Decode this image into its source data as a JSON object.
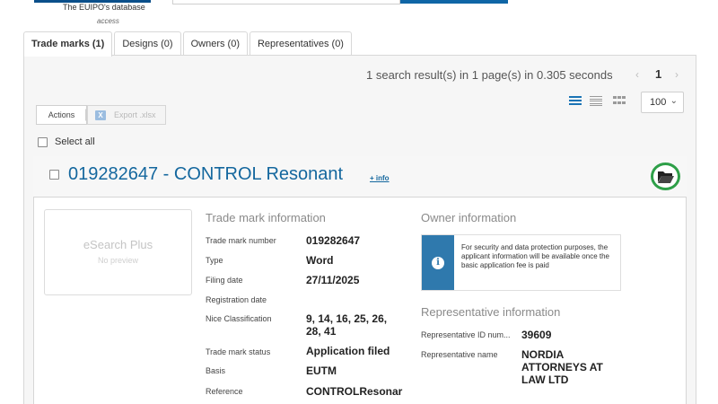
{
  "header": {
    "logo_subtitle": "The EUIPO's database",
    "logo_access": "access"
  },
  "tabs": [
    {
      "label": "Trade marks (1)"
    },
    {
      "label": "Designs (0)"
    },
    {
      "label": "Owners (0)"
    },
    {
      "label": "Representatives (0)"
    }
  ],
  "results": {
    "summary": "1 search result(s) in 1 page(s) in 0.305 seconds",
    "current_page": "1",
    "page_size": "100"
  },
  "toolbar": {
    "actions_label": "Actions",
    "export_label": "Export .xlsx",
    "xlsx_icon_glyph": "X",
    "select_all_label": "Select all"
  },
  "icons": {
    "prev_page": "chevron-left-icon",
    "next_page": "chevron-right-icon",
    "list_view": "list-view-icon",
    "detail_view": "detail-view-icon",
    "grid_view": "grid-view-icon",
    "folder": "folder-open-icon",
    "info": "info-icon",
    "excel": "excel-icon"
  },
  "colors": {
    "link_blue": "#14679e",
    "notice_blue": "#2f79ad",
    "folder_ring_green": "#2e9f48"
  },
  "result": {
    "title": "019282647 - CONTROL Resonant",
    "info_link": "+ info",
    "preview_title": "eSearch Plus",
    "preview_sub": "No preview",
    "tm_section_title": "Trade mark information",
    "tm_fields": [
      {
        "label": "Trade mark number",
        "value": "019282647"
      },
      {
        "label": "Type",
        "value": "Word"
      },
      {
        "label": "Filing date",
        "value": "27/11/2025"
      },
      {
        "label": "Registration date",
        "value": ""
      },
      {
        "label": "Nice Classification",
        "value_line1": "9, 14, 16, 25, 26,",
        "value_line2": "28, 41"
      },
      {
        "label": "Trade mark status",
        "value": "Application filed"
      },
      {
        "label": "Basis",
        "value": "EUTM"
      },
      {
        "label": "Reference",
        "value": "CONTROLResonar"
      }
    ],
    "owner_section_title": "Owner information",
    "owner_notice": "For security and data protection purposes, the applicant information will be available once the basic application fee is paid",
    "rep_section_title": "Representative information",
    "rep_fields": [
      {
        "label": "Representative ID num...",
        "value": "39609"
      },
      {
        "label": "Representative name",
        "value_line1": "NORDIA",
        "value_line2": "ATTORNEYS AT",
        "value_line3": "LAW LTD"
      }
    ]
  }
}
